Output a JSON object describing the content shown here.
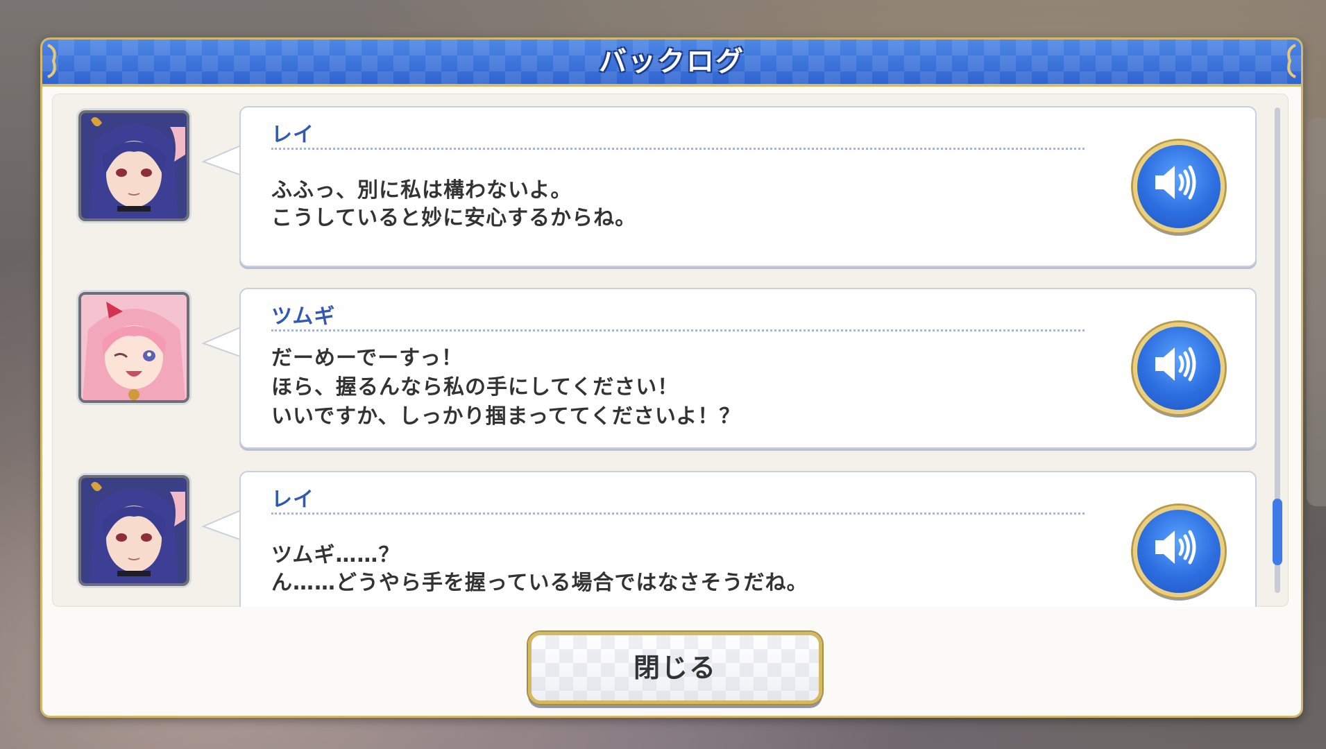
{
  "dialog": {
    "title": "バックログ",
    "close_label": "閉じる"
  },
  "entries": [
    {
      "speaker": "レイ",
      "avatar": "rei-portrait",
      "lines": [
        "ふふっ、別に私は構わないよ。",
        "こうしていると妙に安心するからね。"
      ]
    },
    {
      "speaker": "ツムギ",
      "avatar": "tsumugi-portrait",
      "lines": [
        "だーめーでーすっ！",
        "ほら、握るんなら私の手にしてください！",
        "いいですか、しっかり掴まっててくださいよ！？"
      ]
    },
    {
      "speaker": "レイ",
      "avatar": "rei-portrait",
      "lines": [
        "ツムギ……？",
        "ん……どうやら手を握っている場合ではなさそうだね。"
      ]
    }
  ],
  "icons": {
    "voice": "speaker-volume-icon"
  },
  "colors": {
    "header_blue": "#3a72d9",
    "gold_border": "#d3b76a",
    "speaker_name": "#2f59b5",
    "scroll_thumb": "#3e7be6"
  }
}
